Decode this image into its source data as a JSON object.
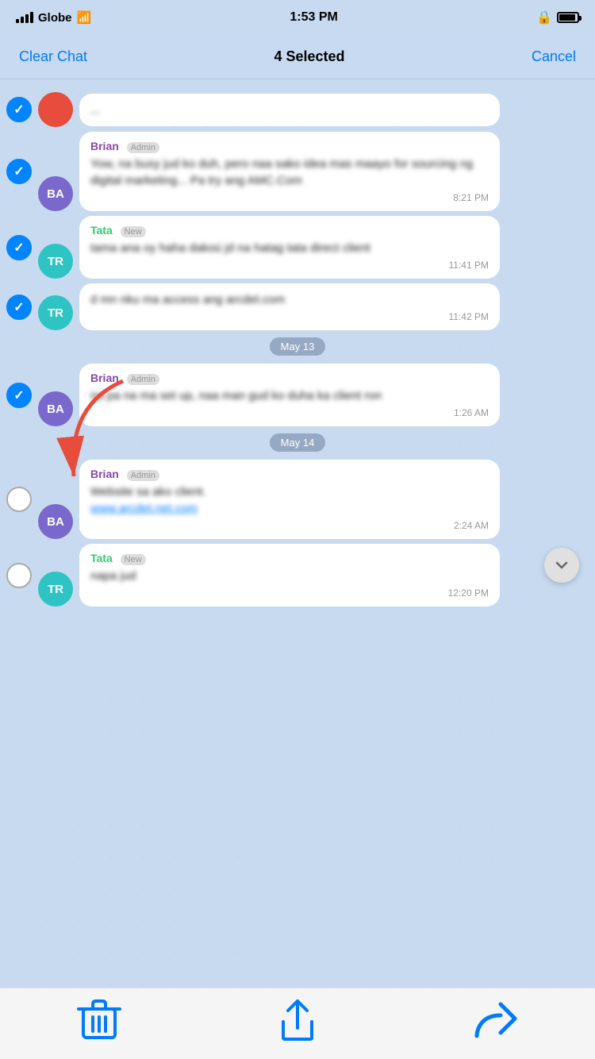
{
  "statusBar": {
    "carrier": "Globe",
    "time": "1:53 PM",
    "lockIcon": "🔒"
  },
  "navBar": {
    "clearChat": "Clear Chat",
    "title": "4 Selected",
    "cancel": "Cancel"
  },
  "messages": [
    {
      "id": "msg1",
      "selected": true,
      "avatarType": "ba",
      "avatarLabel": "BA",
      "senderName": "Brian",
      "senderBadge": "Admin",
      "text": "Yow, na busy jud ko duh, pero naa sako idea mas maayo for sourcing ng digital marketing... Pa try ang AMC.Com",
      "time": "8:21 PM"
    },
    {
      "id": "msg2",
      "selected": true,
      "avatarType": "tr",
      "avatarLabel": "TR",
      "senderName": "Tata",
      "senderBadge": "New",
      "text": "tama ana oy haha dakoú jd na hatag tata direct client",
      "time": "11:41 PM"
    },
    {
      "id": "msg3",
      "selected": true,
      "avatarType": "tr",
      "avatarLabel": "TR",
      "senderName": null,
      "text": "d mn nku ma access ang arcdet.com",
      "time": "11:42 PM"
    },
    {
      "id": "date1",
      "type": "date",
      "label": "May 13"
    },
    {
      "id": "msg4",
      "selected": true,
      "avatarType": "ba",
      "avatarLabel": "BA",
      "senderName": "Brian",
      "senderBadge": "Admin",
      "text": "na pa na ma set up, naa man gud ko duha ka client ron",
      "time": "1:26 AM"
    },
    {
      "id": "date2",
      "type": "date",
      "label": "May 14"
    },
    {
      "id": "msg5",
      "selected": false,
      "avatarType": "ba",
      "avatarLabel": "BA",
      "senderName": "Brian",
      "senderBadge": "Admin",
      "text": "Website sa ako client.",
      "link": "www.arcdet.net.com",
      "time": "2:24 AM"
    },
    {
      "id": "msg6",
      "selected": false,
      "avatarType": "tr",
      "avatarLabel": "TR",
      "senderName": "Tata",
      "senderBadge": "New",
      "text": "napa jud",
      "time": "12:20 PM"
    }
  ],
  "bottomBar": {
    "deleteLabel": "delete",
    "shareLabel": "share",
    "forwardLabel": "forward"
  },
  "scrollDown": "chevron-down"
}
